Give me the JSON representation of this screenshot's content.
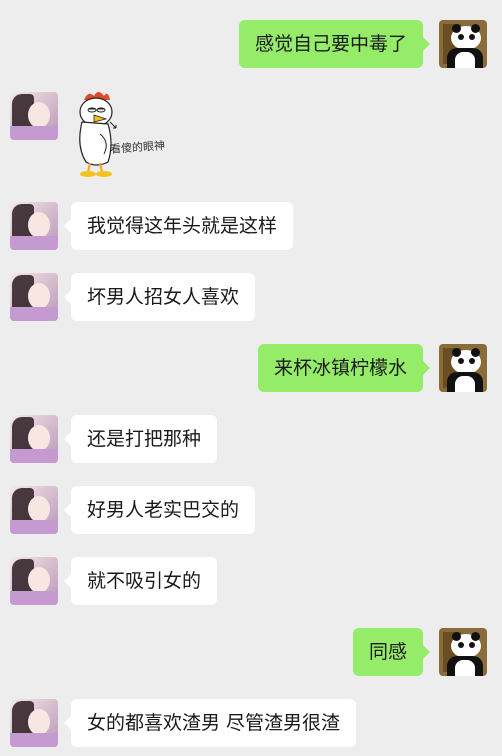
{
  "messages": [
    {
      "side": "out",
      "text": "感觉自己要中毒了"
    },
    {
      "side": "in",
      "type": "sticker",
      "caption": "看傻的眼神"
    },
    {
      "side": "in",
      "text": "我觉得这年头就是这样"
    },
    {
      "side": "in",
      "text": "坏男人招女人喜欢"
    },
    {
      "side": "out",
      "text": "来杯冰镇柠檬水"
    },
    {
      "side": "in",
      "text": "还是打把那种"
    },
    {
      "side": "in",
      "text": "好男人老实巴交的"
    },
    {
      "side": "in",
      "text": "就不吸引女的"
    },
    {
      "side": "out",
      "text": "同感"
    },
    {
      "side": "in",
      "text": "女的都喜欢渣男 尽管渣男很渣"
    }
  ],
  "colors": {
    "background": "#ededed",
    "incoming": "#ffffff",
    "outgoing": "#95ec69"
  }
}
